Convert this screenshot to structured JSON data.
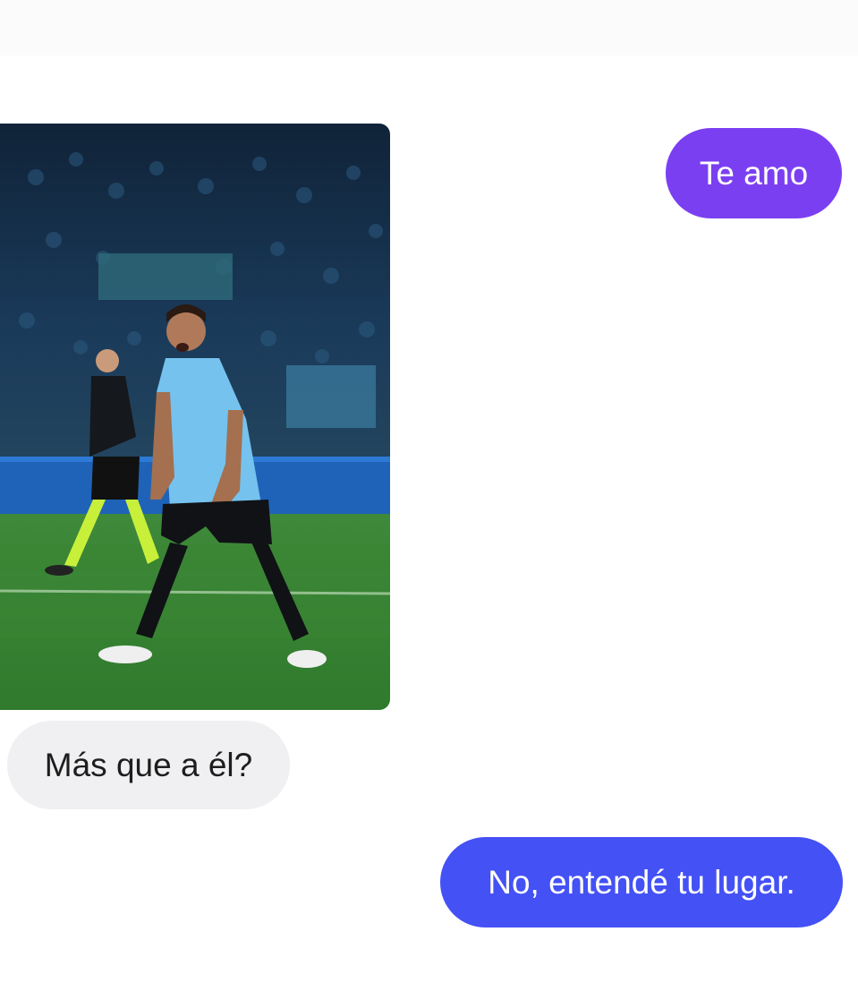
{
  "conversation": {
    "messages": [
      {
        "direction": "outgoing",
        "text": "Te amo"
      },
      {
        "direction": "incoming",
        "type": "photo",
        "caption": ""
      },
      {
        "direction": "incoming",
        "text": "Más que a él?"
      },
      {
        "direction": "outgoing",
        "text": "No, entendé tu lugar."
      }
    ]
  },
  "colors": {
    "outgoing_bubble_1": "#7b3ff2",
    "outgoing_bubble_2": "#4451f5",
    "incoming_bubble": "#f0f0f2",
    "background": "#ffffff"
  },
  "photo": {
    "description_name": "football-player-celebrating-photo"
  }
}
